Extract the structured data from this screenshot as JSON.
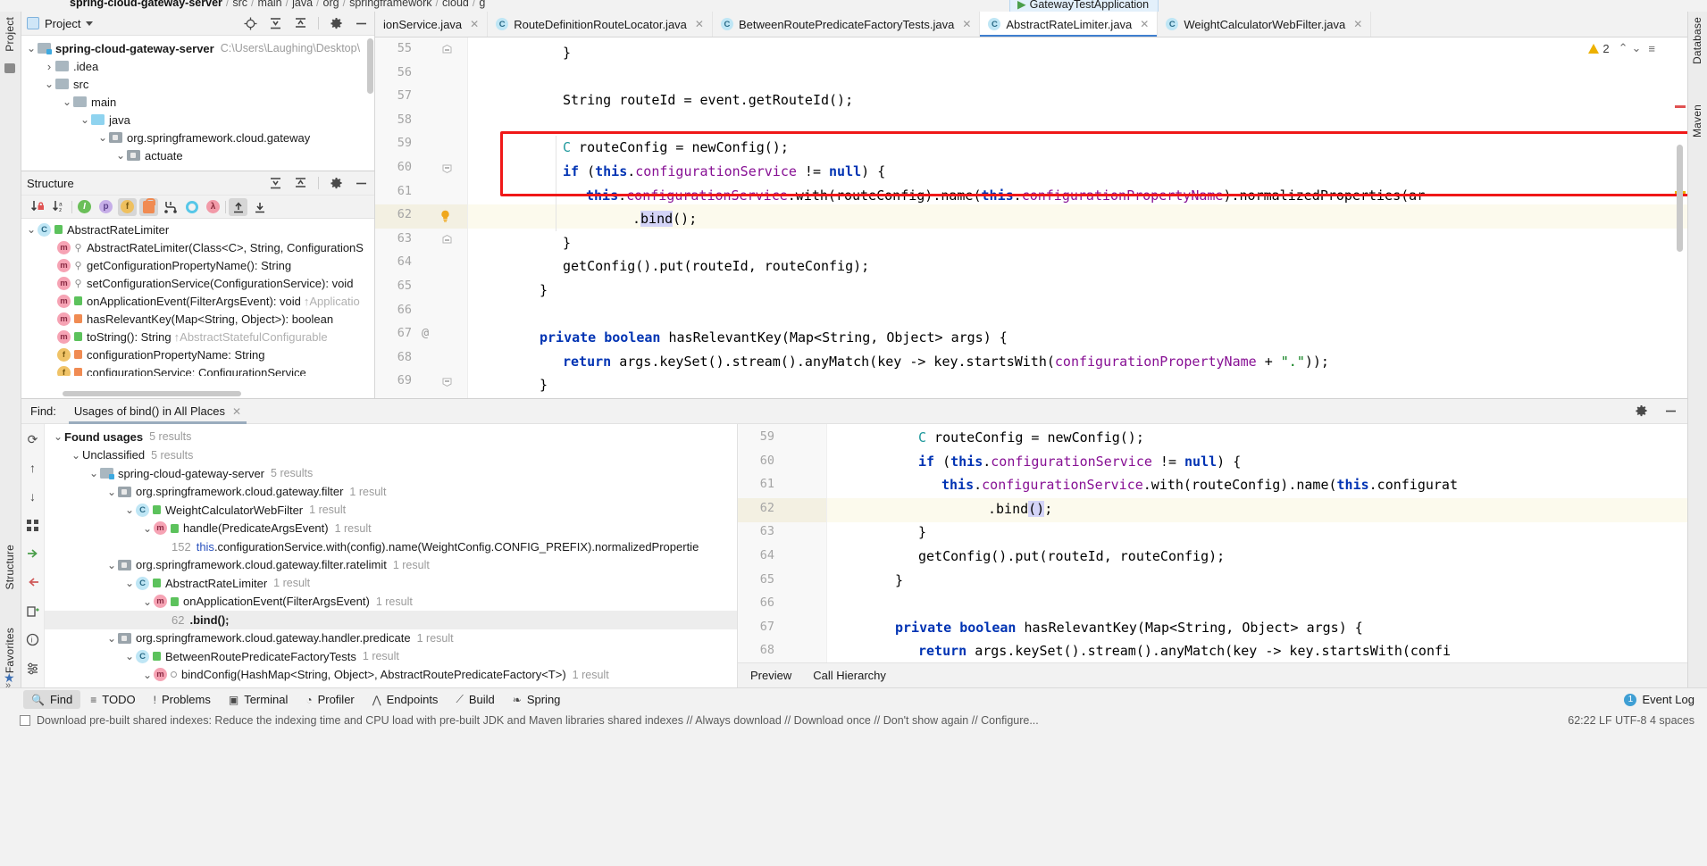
{
  "breadcrumb": {
    "project": "spring-cloud-gateway-server",
    "segments": [
      "src",
      "main",
      "java",
      "org",
      "springframework",
      "cloud",
      "g"
    ]
  },
  "run_widget": {
    "label": "GatewayTestApplication"
  },
  "project_panel": {
    "title": "Project",
    "icons": [
      "locate-icon",
      "expand-all-icon",
      "collapse-all-icon",
      "gear-icon",
      "hide-icon"
    ],
    "tree": [
      {
        "indent": 0,
        "twisty": "v",
        "icon": "module-folder",
        "label": "spring-cloud-gateway-server",
        "bold": true,
        "path": "C:\\Users\\Laughing\\Desktop\\"
      },
      {
        "indent": 1,
        "twisty": ">",
        "icon": "folder",
        "label": ".idea",
        "bold": false,
        "path": ""
      },
      {
        "indent": 1,
        "twisty": "v",
        "icon": "folder",
        "label": "src",
        "bold": false,
        "path": ""
      },
      {
        "indent": 2,
        "twisty": "v",
        "icon": "folder",
        "label": "main",
        "bold": false,
        "path": ""
      },
      {
        "indent": 3,
        "twisty": "v",
        "icon": "source-folder",
        "label": "java",
        "bold": false,
        "path": ""
      },
      {
        "indent": 4,
        "twisty": "v",
        "icon": "package",
        "label": "org.springframework.cloud.gateway",
        "bold": false,
        "path": ""
      },
      {
        "indent": 5,
        "twisty": "v",
        "icon": "package",
        "label": "actuate",
        "bold": false,
        "path": ""
      }
    ]
  },
  "structure_panel": {
    "title": "Structure",
    "toolbar": [
      {
        "name": "sort-by-visibility-icon",
        "active": false
      },
      {
        "name": "sort-alphabetically-icon",
        "active": false
      },
      {
        "name": "show-inherited-icon",
        "active": false
      },
      {
        "name": "show-properties-icon",
        "active": false
      },
      {
        "name": "show-fields-icon",
        "active": true
      },
      {
        "name": "show-non-public-icon",
        "active": true
      },
      {
        "name": "group-methods-icon",
        "active": false
      },
      {
        "name": "show-anonymous-icon",
        "active": false
      },
      {
        "name": "show-lambdas-icon",
        "active": false
      },
      {
        "name": "expand-all-icon",
        "active": true
      },
      {
        "name": "collapse-all-icon",
        "active": false
      }
    ],
    "rows": [
      {
        "indent": 0,
        "twisty": "v",
        "kind": "c",
        "vis": "green",
        "label": "AbstractRateLimiter",
        "inherit": ""
      },
      {
        "indent": 1,
        "twisty": "",
        "kind": "m",
        "vis": "key",
        "label": "AbstractRateLimiter(Class<C>, String, ConfigurationS",
        "inherit": ""
      },
      {
        "indent": 1,
        "twisty": "",
        "kind": "m",
        "vis": "key",
        "label": "getConfigurationPropertyName(): String",
        "inherit": ""
      },
      {
        "indent": 1,
        "twisty": "",
        "kind": "m",
        "vis": "key",
        "label": "setConfigurationService(ConfigurationService): void",
        "inherit": ""
      },
      {
        "indent": 1,
        "twisty": "",
        "kind": "m",
        "vis": "green",
        "label": "onApplicationEvent(FilterArgsEvent): void",
        "inherit": "↑Applicatio"
      },
      {
        "indent": 1,
        "twisty": "",
        "kind": "m",
        "vis": "orange",
        "label": "hasRelevantKey(Map<String, Object>): boolean",
        "inherit": ""
      },
      {
        "indent": 1,
        "twisty": "",
        "kind": "m",
        "vis": "green",
        "label": "toString(): String",
        "inherit": "↑AbstractStatefulConfigurable"
      },
      {
        "indent": 1,
        "twisty": "",
        "kind": "f",
        "vis": "orange",
        "label": "configurationPropertyName: String",
        "inherit": ""
      },
      {
        "indent": 1,
        "twisty": "",
        "kind": "f",
        "vis": "orange",
        "label": "configurationService: ConfigurationService",
        "inherit": ""
      }
    ]
  },
  "editor_tabs": [
    {
      "label": "ionService.java",
      "icon": "java-class-icon",
      "active": false,
      "truncated": true
    },
    {
      "label": "RouteDefinitionRouteLocator.java",
      "icon": "java-class-icon",
      "active": false,
      "truncated": false
    },
    {
      "label": "BetweenRoutePredicateFactoryTests.java",
      "icon": "java-test-icon",
      "active": false,
      "truncated": false
    },
    {
      "label": "AbstractRateLimiter.java",
      "icon": "java-class-icon",
      "active": true,
      "truncated": false
    },
    {
      "label": "WeightCalculatorWebFilter.java",
      "icon": "java-class-icon",
      "active": false,
      "truncated": false
    }
  ],
  "editor": {
    "warning_count": "2",
    "lines": [
      {
        "num": "55",
        "indent": 3,
        "text": "}"
      },
      {
        "num": "56",
        "indent": 0,
        "text": ""
      },
      {
        "num": "57",
        "indent": 3,
        "text": "String routeId = event.getRouteId();"
      },
      {
        "num": "58",
        "indent": 0,
        "text": ""
      },
      {
        "num": "59",
        "indent": 3,
        "text": "C routeConfig = newConfig();"
      },
      {
        "num": "60",
        "indent": 3,
        "text": "if (this.configurationService != null) {"
      },
      {
        "num": "61",
        "indent": 4,
        "text": "this.configurationService.with(routeConfig).name(this.configurationPropertyName).normalizedProperties(ar"
      },
      {
        "num": "62",
        "indent": 6,
        "text": ".bind();"
      },
      {
        "num": "63",
        "indent": 3,
        "text": "}"
      },
      {
        "num": "64",
        "indent": 3,
        "text": "getConfig().put(routeId, routeConfig);"
      },
      {
        "num": "65",
        "indent": 2,
        "text": "}"
      },
      {
        "num": "66",
        "indent": 0,
        "text": ""
      },
      {
        "num": "67",
        "indent": 2,
        "text": "private boolean hasRelevantKey(Map<String, Object> args) {"
      },
      {
        "num": "68",
        "indent": 3,
        "text": "return args.keySet().stream().anyMatch(key -> key.startsWith(configurationPropertyName + \".\"));"
      },
      {
        "num": "69",
        "indent": 2,
        "text": "}"
      }
    ],
    "highlighted_line": "62",
    "annotation_at_line": "67"
  },
  "find_window": {
    "label": "Find:",
    "tab_title": "Usages of bind() in All Places",
    "side_icons": [
      "rerun-icon",
      "prev-occurrence-icon",
      "next-occurrence-icon",
      "group-by-icon",
      "autoscroll-to-source-icon",
      "autoscroll-from-source-icon",
      "export-icon",
      "help-icon",
      "settings-icon"
    ],
    "header_icons": [
      "gear-icon",
      "hide-icon"
    ],
    "results": [
      {
        "indent": 0,
        "twisty": "v",
        "icon": "",
        "label": "Found usages",
        "bold": true,
        "count": "5 results",
        "lineno": ""
      },
      {
        "indent": 1,
        "twisty": "v",
        "icon": "",
        "label": "Unclassified",
        "bold": false,
        "count": "5 results",
        "lineno": ""
      },
      {
        "indent": 2,
        "twisty": "v",
        "icon": "module-folder",
        "label": "spring-cloud-gateway-server",
        "bold": false,
        "count": "5 results",
        "lineno": ""
      },
      {
        "indent": 3,
        "twisty": "v",
        "icon": "package",
        "label": "org.springframework.cloud.gateway.filter",
        "bold": false,
        "count": "1 result",
        "lineno": ""
      },
      {
        "indent": 4,
        "twisty": "v",
        "icon": "class",
        "label": "WeightCalculatorWebFilter",
        "bold": false,
        "count": "1 result",
        "lineno": ""
      },
      {
        "indent": 5,
        "twisty": "v",
        "icon": "method",
        "label": "handle(PredicateArgsEvent)",
        "bold": false,
        "count": "1 result",
        "lineno": ""
      },
      {
        "indent": 6,
        "twisty": "",
        "icon": "code",
        "label": "this.configurationService.with(config).name(WeightConfig.CONFIG_PREFIX).normalizedPropertie",
        "bold": false,
        "count": "",
        "lineno": "152"
      },
      {
        "indent": 3,
        "twisty": "v",
        "icon": "package",
        "label": "org.springframework.cloud.gateway.filter.ratelimit",
        "bold": false,
        "count": "1 result",
        "lineno": ""
      },
      {
        "indent": 4,
        "twisty": "v",
        "icon": "class",
        "label": "AbstractRateLimiter",
        "bold": false,
        "count": "1 result",
        "lineno": ""
      },
      {
        "indent": 5,
        "twisty": "v",
        "icon": "method",
        "label": "onApplicationEvent(FilterArgsEvent)",
        "bold": false,
        "count": "1 result",
        "lineno": ""
      },
      {
        "indent": 6,
        "twisty": "",
        "icon": "code",
        "label": ".bind();",
        "bold": true,
        "count": "",
        "lineno": "62",
        "selected": true
      },
      {
        "indent": 3,
        "twisty": "v",
        "icon": "package",
        "label": "org.springframework.cloud.gateway.handler.predicate",
        "bold": false,
        "count": "1 result",
        "lineno": ""
      },
      {
        "indent": 4,
        "twisty": "v",
        "icon": "class-test",
        "label": "BetweenRoutePredicateFactoryTests",
        "bold": false,
        "count": "1 result",
        "lineno": ""
      },
      {
        "indent": 5,
        "twisty": "v",
        "icon": "method-test",
        "label": "bindConfig(HashMap<String, Object>, AbstractRoutePredicateFactory<T>)",
        "bold": false,
        "count": "1 result",
        "lineno": ""
      }
    ]
  },
  "preview": {
    "lines": [
      {
        "num": "59",
        "indent": 3,
        "text": "C routeConfig = newConfig();"
      },
      {
        "num": "60",
        "indent": 3,
        "text": "if (this.configurationService != null) {"
      },
      {
        "num": "61",
        "indent": 4,
        "text": "this.configurationService.with(routeConfig).name(this.configurat"
      },
      {
        "num": "62",
        "indent": 6,
        "text": ".bind();"
      },
      {
        "num": "63",
        "indent": 3,
        "text": "}"
      },
      {
        "num": "64",
        "indent": 3,
        "text": "getConfig().put(routeId, routeConfig);"
      },
      {
        "num": "65",
        "indent": 2,
        "text": "}"
      },
      {
        "num": "66",
        "indent": 0,
        "text": ""
      },
      {
        "num": "67",
        "indent": 2,
        "text": "private boolean hasRelevantKey(Map<String, Object> args) {"
      },
      {
        "num": "68",
        "indent": 3,
        "text": "return args.keySet().stream().anyMatch(key -> key.startsWith(confi"
      }
    ],
    "highlighted_line": "62",
    "tabs": [
      {
        "label": "Preview",
        "active": true
      },
      {
        "label": "Call Hierarchy",
        "active": false
      }
    ]
  },
  "bottom_bar": {
    "items": [
      {
        "label": "Find",
        "icon": "search-icon",
        "active": true
      },
      {
        "label": "TODO",
        "icon": "list-icon",
        "active": false
      },
      {
        "label": "Problems",
        "icon": "error-icon",
        "active": false
      },
      {
        "label": "Terminal",
        "icon": "terminal-icon",
        "active": false
      },
      {
        "label": "Profiler",
        "icon": "profiler-icon",
        "active": false
      },
      {
        "label": "Endpoints",
        "icon": "endpoints-icon",
        "active": false
      },
      {
        "label": "Build",
        "icon": "hammer-icon",
        "active": false
      },
      {
        "label": "Spring",
        "icon": "spring-leaf-icon",
        "active": false
      }
    ],
    "event_log": {
      "label": "Event Log",
      "badge": "1"
    }
  },
  "status_line": {
    "text": "Download pre-built shared indexes: Reduce the indexing time and CPU load with pre-built JDK and Maven libraries shared indexes // Always download // Download once // Don't show again // Configure...",
    "right": "62:22  LF  UTF-8  4 spaces"
  },
  "tool_strips": {
    "left": [
      "Project",
      "Structure",
      "Favorites"
    ],
    "right": [
      "Database",
      "Maven"
    ]
  }
}
